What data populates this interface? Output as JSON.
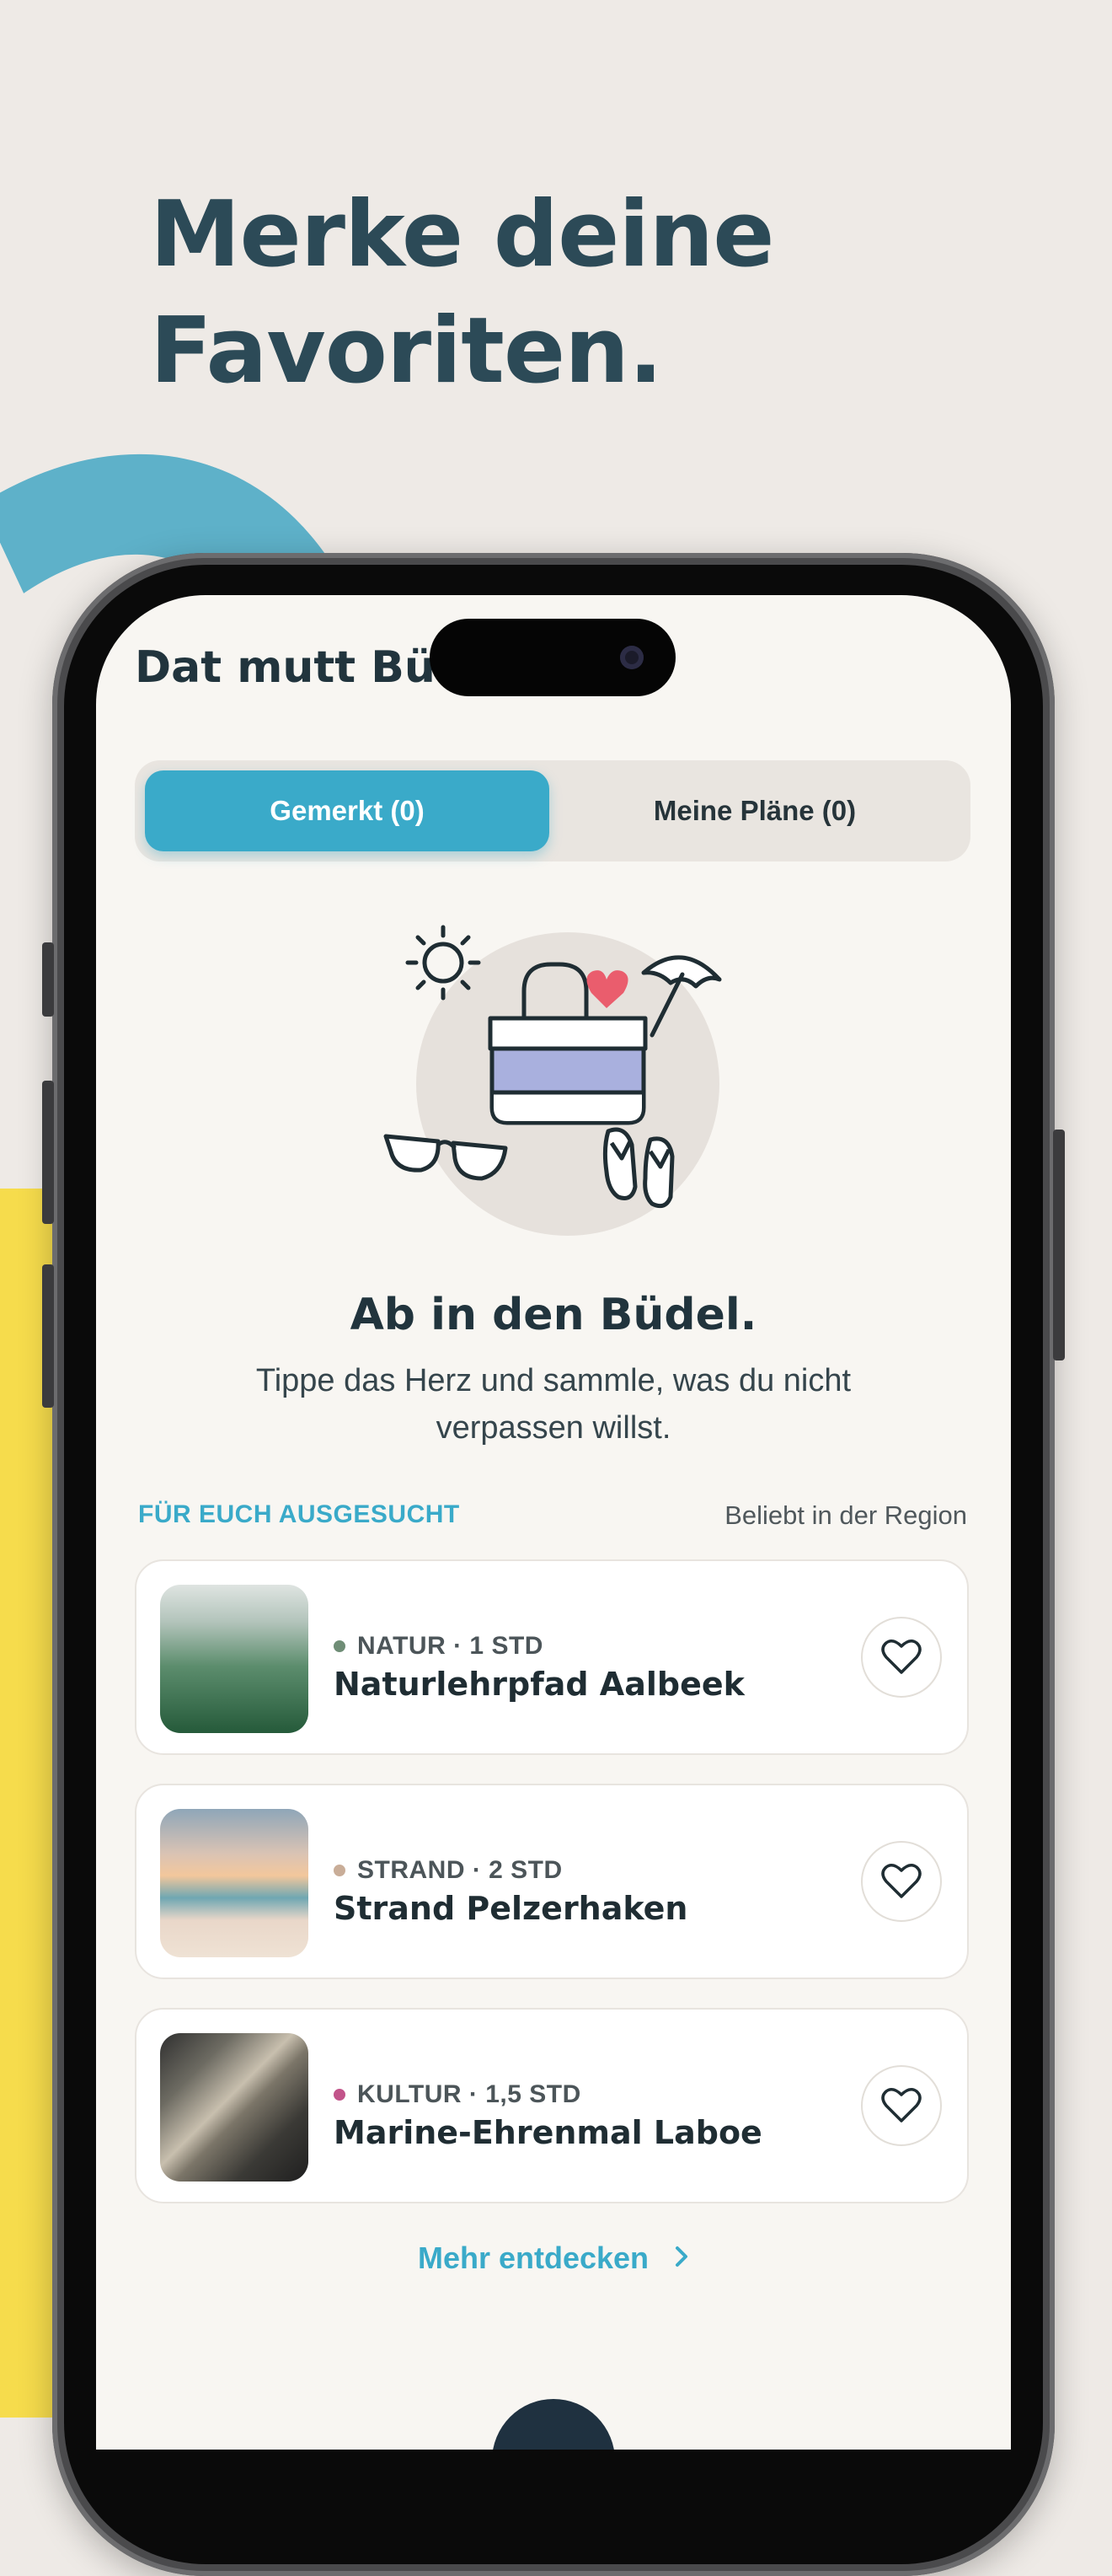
{
  "headline": {
    "line1": "Merke deine",
    "line2": "Favoriten."
  },
  "app": {
    "title": "Dat mutt Büdel",
    "tabs": [
      {
        "label": "Gemerkt (0)",
        "active": true
      },
      {
        "label": "Meine Pläne (0)",
        "active": false
      }
    ]
  },
  "empty_state": {
    "title": "Ab in den Büdel.",
    "text": "Tippe das Herz und sammle, was du nicht verpassen willst."
  },
  "suggestions": {
    "heading": "FÜR EUCH AUSGESUCHT",
    "meta": "Beliebt in der Region",
    "items": [
      {
        "category": "NATUR · 1 STD",
        "name": "Naturlehrpfad Aalbeek",
        "dot_color": "#6f8d76",
        "image": "forest"
      },
      {
        "category": "STRAND · 2 STD",
        "name": "Strand Pelzerhaken",
        "dot_color": "#c9ad98",
        "image": "beach"
      },
      {
        "category": "KULTUR · 1,5 STD",
        "name": "Marine-Ehrenmal Laboe",
        "dot_color": "#c2548a",
        "image": "memorial"
      }
    ],
    "more_label": "Mehr entdecken"
  },
  "colors": {
    "accent": "#3aaac9",
    "headline": "#2c4a57",
    "background": "#eeeae6",
    "yellow": "#f6dc4c",
    "blue": "#5eb1c9"
  },
  "icons": [
    "heart-icon",
    "chevron-right-icon",
    "sun-icon",
    "umbrella-icon",
    "bag-icon",
    "sunglasses-icon",
    "flip-flops-icon"
  ]
}
